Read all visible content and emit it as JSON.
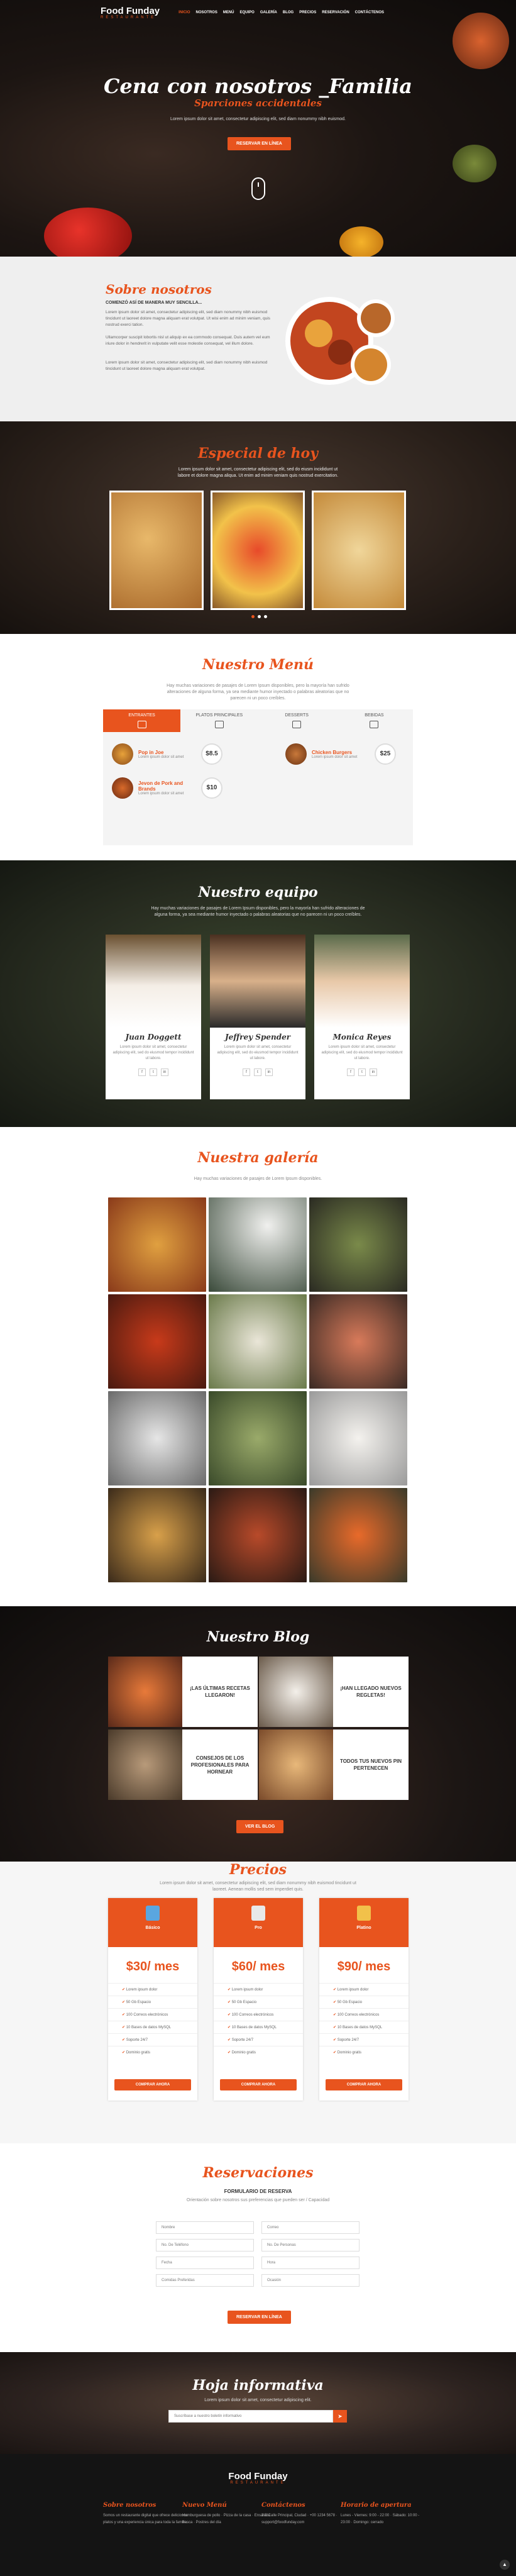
{
  "nav": {
    "brand": "Food Funday",
    "tagline": "RESTAURANTE",
    "items": [
      "Inicio",
      "Nosotros",
      "Menú",
      "Equipo",
      "Galería",
      "Blog",
      "Precios",
      "Reservación",
      "Contáctenos"
    ]
  },
  "hero": {
    "title": "Cena con nosotros _Familia",
    "subtitle": "Sparciones accidentales",
    "text": "Lorem ipsum dolor sit amet, consectetur adipiscing elit, sed diam nonummy nibh euismod.",
    "button": "Reservar en línea"
  },
  "about": {
    "title": "Sobre nosotros",
    "heading": "COMENZÓ ASÍ DE MANERA MUY SENCILLA...",
    "p1": "Lorem ipsum dolor sit amet, consectetur adipiscing elit, sed diam nonummy nibh euismod tincidunt ut laoreet dolore magna aliquam erat volutpat. Ut wisi enim ad minim veniam, quis nostrud exerci tation.",
    "p2": "Ullamcorper suscipit lobortis nisl ut aliquip ex ea commodo consequat. Duis autem vel eum iriure dolor in hendrerit in vulputate velit esse molestie consequat, vel illum dolore.",
    "p3": "Lorem ipsum dolor sit amet, consectetur adipiscing elit, sed diam nonummy nibh euismod tincidunt ut laoreet dolore magna aliquam erat volutpat."
  },
  "specials": {
    "title": "Especial de hoy",
    "text": "Lorem ipsum dolor sit amet, consectetur adipiscing elit, sed do eiusm incididunt ut labore et dolore magna aliqua. Ut enim ad minim veniam quis nostrud exercitation."
  },
  "menu": {
    "title": "Nuestro Menú",
    "text": "Hay muchas variaciones de pasajes de Lorem Ipsum disponibles, pero la mayoría han sufrido alteraciones de alguna forma, ya sea mediante humor inyectado o palabras aleatorias que no parecen ni un poco creíbles.",
    "tabs": [
      "Entrantes",
      "Platos principales",
      "Desserts",
      "Bebidas"
    ],
    "items": [
      {
        "name": "Pop in Joe",
        "desc": "Lorem ipsum dolor sit amet",
        "price": "$8.5"
      },
      {
        "name": "Chicken Burgers",
        "desc": "Lorem ipsum dolor sit amet",
        "price": "$25"
      },
      {
        "name": "Jevon de Pork and Brands",
        "desc": "Lorem ipsum dolor sit amet",
        "price": "$10"
      }
    ]
  },
  "team": {
    "title": "Nuestro equipo",
    "text": "Hay muchas variaciones de pasajes de Lorem Ipsum disponibles, pero la mayoría han sufrido alteraciones de alguna forma, ya sea mediante humor inyectado o palabras aleatorias que no parecen ni un poco creíbles.",
    "members": [
      {
        "name": "Juan Doggett",
        "bio": "Lorem ipsum dolor sit amet, consectetur adipiscing elit, sed do eiusmod tempor incididunt ut labore."
      },
      {
        "name": "Jeffrey Spender",
        "bio": "Lorem ipsum dolor sit amet, consectetur adipiscing elit, sed do eiusmod tempor incididunt ut labore."
      },
      {
        "name": "Monica Reyes",
        "bio": "Lorem ipsum dolor sit amet, consectetur adipiscing elit, sed do eiusmod tempor incididunt ut labore."
      }
    ]
  },
  "gallery": {
    "title": "Nuestra galería",
    "text": "Hay muchas variaciones de pasajes de Lorem Ipsum disponibles."
  },
  "blog": {
    "title": "Nuestro Blog",
    "posts": [
      "¡Las últimas recetas llegaron!",
      "¡Han llegado nuevos regletas!",
      "Consejos de los profesionales para hornear",
      "Todos tus nuevos pin PERTENECEN"
    ],
    "button": "Ver el blog"
  },
  "prices": {
    "title": "Precios",
    "text": "Lorem ipsum dolor sit amet, consectetur adipiscing elit, sed diam nonummy nibh euismod tincidunt ut laoreet. Aenean mollis sed sem imperdiet quis.",
    "plans": [
      {
        "name": "Básico",
        "amount": "$30/",
        "period": "mes"
      },
      {
        "name": "Pro",
        "amount": "$60/",
        "period": "mes"
      },
      {
        "name": "Platino",
        "amount": "$90/",
        "period": "mes"
      }
    ],
    "features": [
      "Lorem ipsum dolor",
      "50 Gb Espacio",
      "100 Correos electrónicos",
      "10 Bases de datos MySQL",
      "Soporte 24/7",
      "Dominio gratis"
    ],
    "button": "Comprar ahora"
  },
  "reserv": {
    "title": "Reservaciones",
    "form_title": "FORMULARIO DE RESERVA",
    "text": "Orientación sobre nosotros sus preferencias que pueden ser / Capacidad",
    "fields": [
      "Nombre",
      "Correo",
      "No. De Teléfono",
      "No. De Personas",
      "Fecha",
      "Hora",
      "Comidas Preferidas",
      "Ocasión"
    ],
    "button": "Reservar en línea"
  },
  "news": {
    "title": "Hoja informativa",
    "text": "Lorem ipsum dolor sit amet, consectetur adipiscing elit.",
    "placeholder": "Suscríbase a nuestro boletín informativo",
    "button": "➤"
  },
  "footer": {
    "brand": "Food Funday",
    "tagline": "RESTAURANTE",
    "cols": [
      {
        "title": "Sobre nosotros",
        "text": "Somos un restaurante digital que ofrece deliciosos platos y una experiencia única para toda la familia."
      },
      {
        "title": "Nuevo Menú",
        "text": "Hamburguesa de pollo · Pizza de la casa · Ensalada fresca · Postres del día"
      },
      {
        "title": "Contáctenos",
        "text": "3 B Calle Principal, Ciudad · +00 1234 5678 · support@foodfunday.com"
      },
      {
        "title": "Horario de apertura",
        "text": "Lunes - Viernes: 9:00 - 22:00 · Sábado: 10:00 - 23:00 · Domingo: cerrado"
      }
    ]
  }
}
